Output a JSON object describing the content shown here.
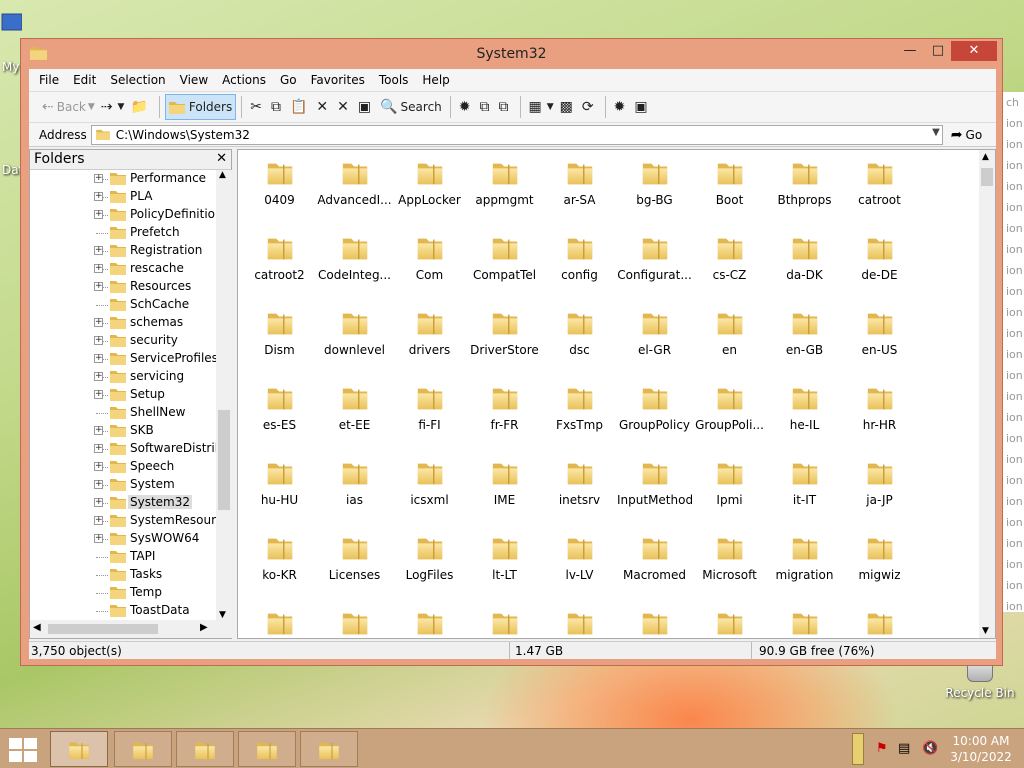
{
  "window": {
    "title": "System32"
  },
  "menu": [
    "File",
    "Edit",
    "Selection",
    "View",
    "Actions",
    "Go",
    "Favorites",
    "Tools",
    "Help"
  ],
  "toolbar": {
    "back": "Back",
    "folders": "Folders",
    "search": "Search"
  },
  "address": {
    "label": "Address",
    "value": "C:\\Windows\\System32",
    "go": "Go"
  },
  "folders_pane": {
    "title": "Folders",
    "items": [
      {
        "label": "Performance",
        "expandable": true
      },
      {
        "label": "PLA",
        "expandable": true
      },
      {
        "label": "PolicyDefinitions",
        "expandable": true
      },
      {
        "label": "Prefetch",
        "expandable": false
      },
      {
        "label": "Registration",
        "expandable": true
      },
      {
        "label": "rescache",
        "expandable": true
      },
      {
        "label": "Resources",
        "expandable": true
      },
      {
        "label": "SchCache",
        "expandable": false
      },
      {
        "label": "schemas",
        "expandable": true
      },
      {
        "label": "security",
        "expandable": true
      },
      {
        "label": "ServiceProfiles",
        "expandable": true
      },
      {
        "label": "servicing",
        "expandable": true
      },
      {
        "label": "Setup",
        "expandable": true
      },
      {
        "label": "ShellNew",
        "expandable": false
      },
      {
        "label": "SKB",
        "expandable": true
      },
      {
        "label": "SoftwareDistribution",
        "expandable": true
      },
      {
        "label": "Speech",
        "expandable": true
      },
      {
        "label": "System",
        "expandable": true
      },
      {
        "label": "System32",
        "expandable": true,
        "selected": true
      },
      {
        "label": "SystemResources",
        "expandable": true
      },
      {
        "label": "SysWOW64",
        "expandable": true
      },
      {
        "label": "TAPI",
        "expandable": false
      },
      {
        "label": "Tasks",
        "expandable": false
      },
      {
        "label": "Temp",
        "expandable": false
      },
      {
        "label": "ToastData",
        "expandable": false
      }
    ]
  },
  "files": [
    "0409",
    "AdvancedI...",
    "AppLocker",
    "appmgmt",
    "ar-SA",
    "bg-BG",
    "Boot",
    "Bthprops",
    "catroot",
    "catroot2",
    "CodeInteg...",
    "Com",
    "CompatTel",
    "config",
    "Configurat...",
    "cs-CZ",
    "da-DK",
    "de-DE",
    "Dism",
    "downlevel",
    "drivers",
    "DriverStore",
    "dsc",
    "el-GR",
    "en",
    "en-GB",
    "en-US",
    "es-ES",
    "et-EE",
    "fi-FI",
    "fr-FR",
    "FxsTmp",
    "GroupPolicy",
    "GroupPoli...",
    "he-IL",
    "hr-HR",
    "hu-HU",
    "ias",
    "icsxml",
    "IME",
    "inetsrv",
    "InputMethod",
    "Ipmi",
    "it-IT",
    "ja-JP",
    "ko-KR",
    "Licenses",
    "LogFiles",
    "lt-LT",
    "lv-LV",
    "Macromed",
    "Microsoft",
    "migration",
    "migwiz",
    "",
    "",
    "",
    "",
    "",
    "",
    "",
    "",
    ""
  ],
  "status": {
    "objects": "3,750 object(s)",
    "size": "1.47 GB",
    "free": "90.9 GB free (76%)"
  },
  "desktop": {
    "left_labels": [
      "My",
      "Dat"
    ],
    "recycle_bin": "Recycle Bin",
    "right_peek_lines": [
      "ch D",
      "ion",
      "ion",
      "ion",
      "ion",
      "ion",
      "ion",
      "ion",
      "ion",
      "ion",
      "ion",
      "ion",
      "ion",
      "ion",
      "ion",
      "ion",
      "ion",
      "ion",
      "ion",
      "ion",
      "ion",
      "ion",
      "ion",
      "ion",
      "ion"
    ]
  },
  "taskbar": {
    "time": "10:00 AM",
    "date": "3/10/2022"
  },
  "colors": {
    "folder_yellow": "#f2d27a",
    "title_frame": "#e8a080",
    "close_red": "#c7463a",
    "taskbar": "#c9a27e"
  }
}
